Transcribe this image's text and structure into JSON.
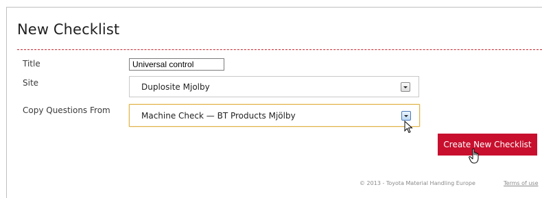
{
  "page": {
    "heading": "New Checklist"
  },
  "form": {
    "title_label": "Title",
    "title_value": "Universal control",
    "site_label": "Site",
    "site_value": "Duplosite Mjolby",
    "copy_label": "Copy Questions From",
    "copy_value": "Machine Check — BT Products Mjölby"
  },
  "actions": {
    "create_label": "Create New Checklist"
  },
  "footer": {
    "copyright": "© 2013 - Toyota Material Handling Europe",
    "terms_link": "Terms of use"
  },
  "icons": {
    "dropdown": "chevron-down-icon",
    "arrow_cursor": "arrow-cursor-icon",
    "hand_cursor": "hand-pointer-icon"
  },
  "colors": {
    "accent": "#c8102e",
    "divider": "#c4262e",
    "focus_border": "#e0b24a"
  }
}
